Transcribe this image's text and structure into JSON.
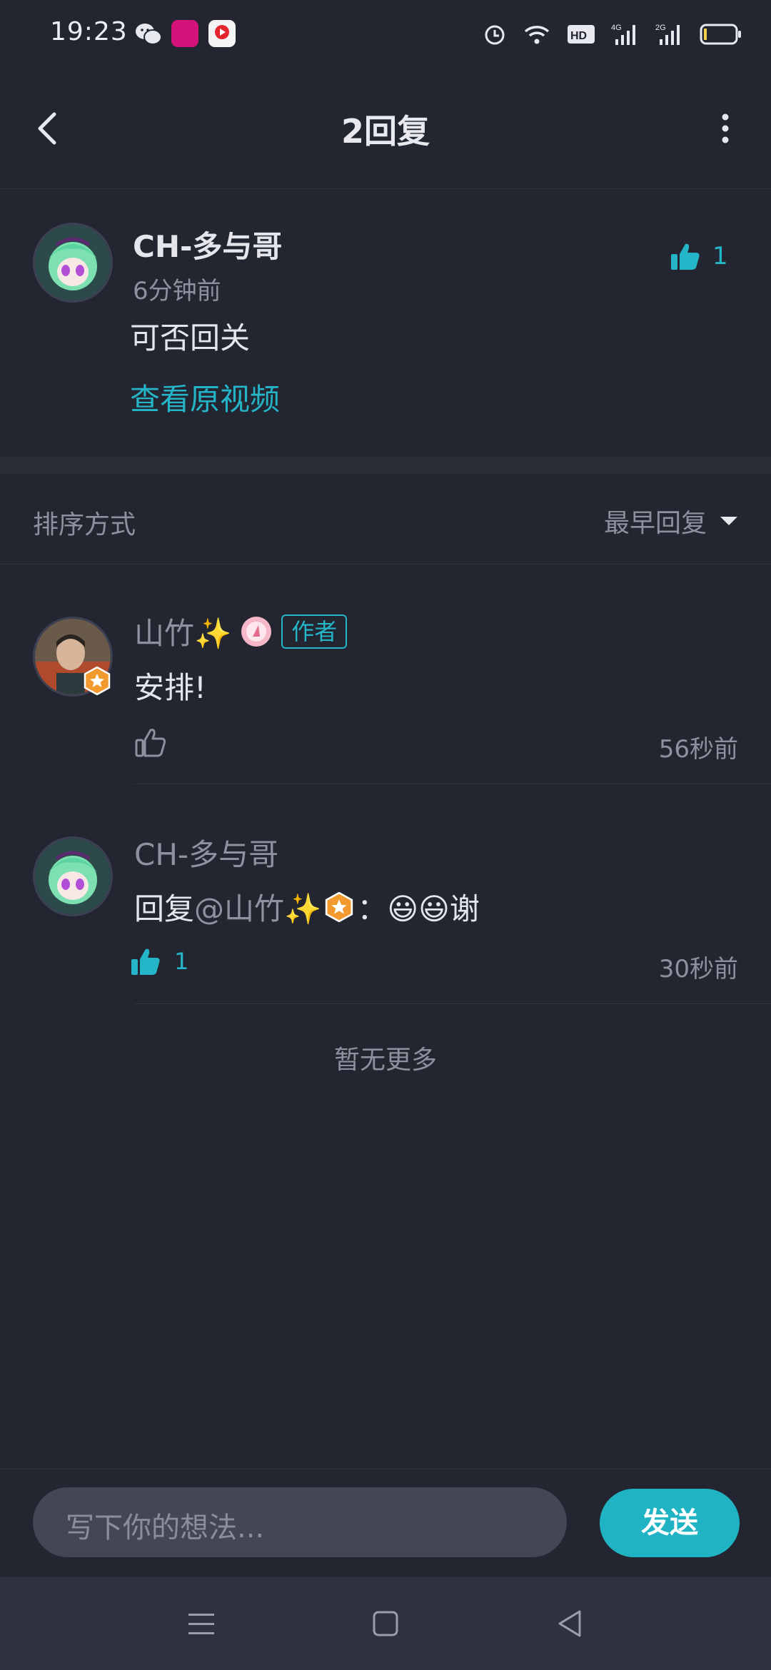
{
  "status_bar": {
    "time": "19:23"
  },
  "header": {
    "title": "2回复"
  },
  "main_comment": {
    "author": "CH-多与哥",
    "time": "6分钟前",
    "text": "可否回关",
    "like_count": "1",
    "view_video_label": "查看原视频"
  },
  "sort": {
    "label": "排序方式",
    "selected": "最早回复"
  },
  "replies": [
    {
      "author": "山竹✨",
      "badge": "作者",
      "text": "安排!",
      "time": "56秒前",
      "like_count": ""
    },
    {
      "author": "CH-多与哥",
      "text_prefix": "回复",
      "mention": "@山竹✨",
      "text_suffix": "：😃😃谢",
      "time": "30秒前",
      "like_count": "1"
    }
  ],
  "no_more_text": "暂无更多",
  "input": {
    "placeholder": "写下你的想法...",
    "send_label": "发送"
  },
  "colors": {
    "accent": "#25b5c8",
    "background": "#232530",
    "send_button": "#1fb3c3"
  }
}
